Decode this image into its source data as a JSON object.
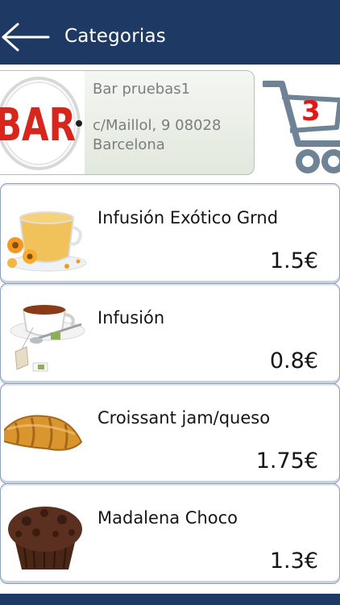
{
  "header": {
    "title": "Categorias",
    "back_icon": "arrow-left-icon"
  },
  "bar": {
    "logo_text": "BAR",
    "name": "Bar pruebas1",
    "address": "c/Maillol, 9 08028 Barcelona"
  },
  "cart": {
    "icon": "shopping-cart-icon",
    "count": "3"
  },
  "products": [
    {
      "name": "Infusión Exótico Grnd",
      "price": "1.5€",
      "image": "tea-cup-flowers-image"
    },
    {
      "name": "Infusión",
      "price": "0.8€",
      "image": "tea-cup-teabag-image"
    },
    {
      "name": "Croissant jam/queso",
      "price": "1.75€",
      "image": "croissant-image"
    },
    {
      "name": "Madalena Choco",
      "price": "1.3€",
      "image": "chocolate-muffin-image"
    }
  ],
  "colors": {
    "header": "#1e3a64",
    "cart": "#6f8396",
    "cart_count": "#e21818",
    "logo_red": "#d9261c"
  }
}
